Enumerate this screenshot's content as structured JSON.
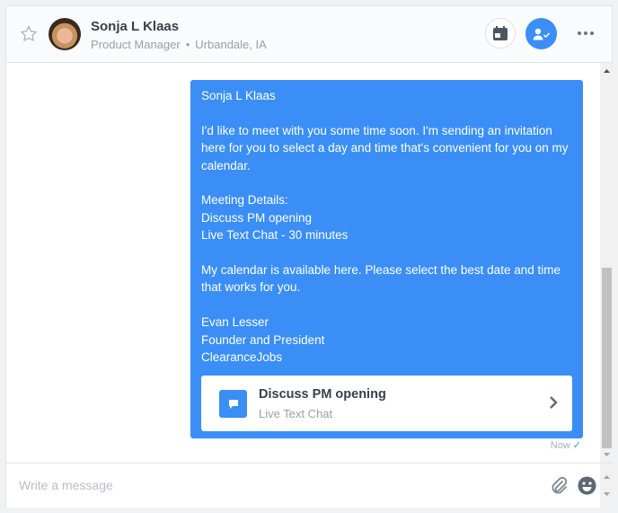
{
  "header": {
    "contact_name": "Sonja L Klaas",
    "job_title": "Product Manager",
    "separator": "•",
    "location": "Urbandale, IA",
    "icons": {
      "favorite": "star-outline-icon",
      "calendar": "calendar-icon",
      "user": "user-check-icon",
      "more": "more-horizontal-icon"
    }
  },
  "message": {
    "lines": [
      "Sonja L Klaas",
      "",
      "I'd like to meet with you some time soon. I'm sending an invitation here for you to select a day and time that's convenient for you on my calendar.",
      "",
      "Meeting Details:",
      "Discuss PM opening",
      "Live Text Chat - 30 minutes",
      "",
      "My calendar is available here. Please select the best date and time that works for you.",
      "",
      "Evan Lesser",
      "Founder and President",
      "ClearanceJobs"
    ],
    "card": {
      "title": "Discuss PM opening",
      "subtitle": "Live Text Chat",
      "icon": "chat-bubble-icon"
    },
    "timestamp": "Now",
    "status": "✓"
  },
  "scroll": {
    "position_fraction": 1.0
  },
  "composer": {
    "placeholder": "Write a message",
    "value": "",
    "icons": {
      "attach": "paperclip-icon",
      "emoji": "emoji-icon"
    }
  },
  "colors": {
    "accent": "#3a8ef6",
    "text_dark": "#36414d",
    "text_muted": "#97a1ab"
  }
}
